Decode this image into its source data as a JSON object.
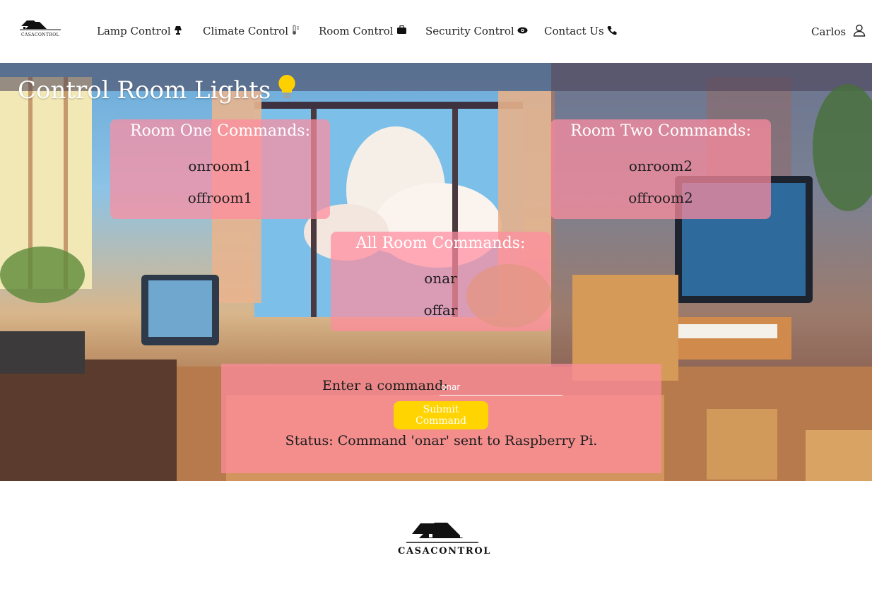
{
  "brand": {
    "name": "CASACONTROL"
  },
  "nav": [
    {
      "label": "Lamp Control",
      "icon": "lamp-icon",
      "glyph": "🛋"
    },
    {
      "label": "Climate Control",
      "icon": "thermometer-icon",
      "glyph": "🌡"
    },
    {
      "label": "Room Control",
      "icon": "briefcase-icon",
      "glyph": "💼"
    },
    {
      "label": "Security Control",
      "icon": "eye-icon",
      "glyph": "👁"
    },
    {
      "label": "Contact Us",
      "icon": "phone-icon",
      "glyph": "📞"
    }
  ],
  "user": {
    "name": "Carlos",
    "icon": "user-icon"
  },
  "hero": {
    "title": "Control Room Lights",
    "title_icon": "lightbulb-icon",
    "room_one": {
      "heading": "Room One Commands:",
      "commands": [
        "onroom1",
        "offroom1"
      ]
    },
    "room_two": {
      "heading": "Room Two Commands:",
      "commands": [
        "onroom2",
        "offroom2"
      ]
    },
    "all_rooms": {
      "heading": "All Room Commands:",
      "commands": [
        "onar",
        "offar"
      ]
    }
  },
  "command_form": {
    "label": "Enter a command:",
    "value": "onar",
    "submit_label": "Submit Command",
    "status": "Status: Command 'onar' sent to Raspberry Pi."
  },
  "colors": {
    "card": "#ff8ca0",
    "button": "#ffd400",
    "title": "#ffffff"
  }
}
